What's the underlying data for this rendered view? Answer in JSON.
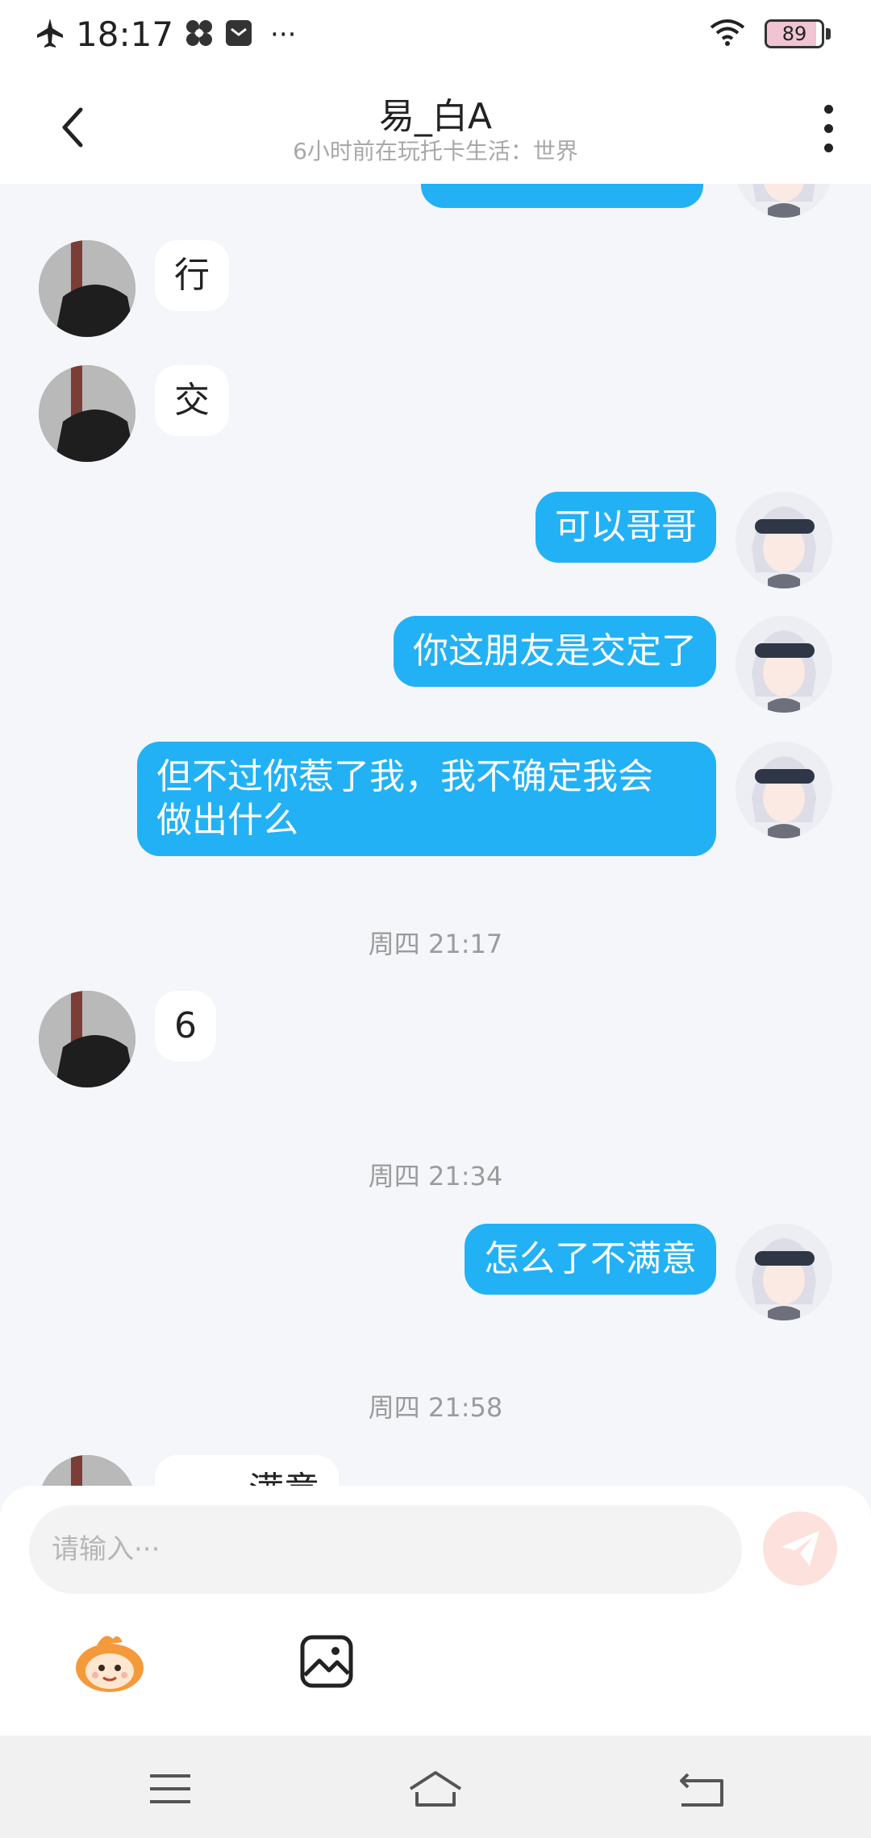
{
  "status_bar": {
    "time": "18:17",
    "more": "···",
    "battery": "89",
    "battery_level": 0.89,
    "icons": [
      "airplane-icon",
      "pinwheel-icon",
      "message-app-icon",
      "wifi-icon",
      "battery-icon"
    ]
  },
  "header": {
    "title": "易_白A",
    "subtitle": "6小时前在玩托卡生活：世界"
  },
  "messages": [
    {
      "side": "in",
      "text": "行"
    },
    {
      "side": "in",
      "text": "交"
    },
    {
      "side": "out",
      "text": "可以哥哥"
    },
    {
      "side": "out",
      "text": "你这朋友是交定了"
    },
    {
      "side": "out",
      "text_line1": "但不过你惹了我，我不确定我会",
      "text_line2": "做出什么"
    },
    {
      "side": "in",
      "text": "6"
    },
    {
      "side": "out",
      "text": "怎么了不满意"
    },
    {
      "side": "in",
      "text": "满意"
    }
  ],
  "timestamps": [
    "周四 21:17",
    "周四 21:34",
    "周四 21:58"
  ],
  "input": {
    "placeholder": "请输入···"
  },
  "colors": {
    "outgoing_bubble": "#22b1f5",
    "incoming_bubble": "#ffffff",
    "background": "#f4f6f9",
    "send_button": "#fde1dc"
  },
  "nav_icons": [
    "menu-icon",
    "home-icon",
    "back-nav-icon"
  ]
}
